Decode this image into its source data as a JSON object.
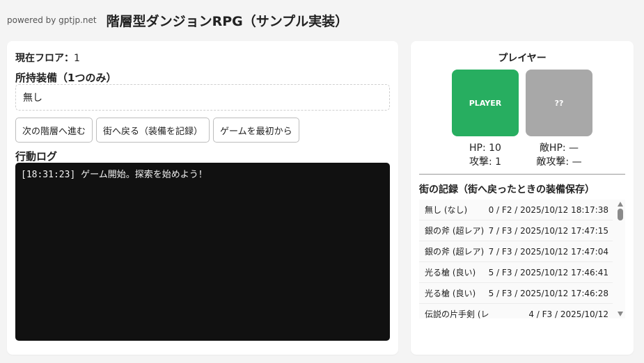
{
  "header": {
    "powered_by": "powered by gptjp.net",
    "title": "階層型ダンジョンRPG（サンプル実装）"
  },
  "left": {
    "floor_label": "現在フロア：",
    "floor_value": "1",
    "equip_label": "所持装備（1つのみ）",
    "equip_value": "無し",
    "buttons": {
      "next": "次の階層へ進む",
      "town": "街へ戻る（装備を記録）",
      "restart": "ゲームを最初から"
    },
    "log_label": "行動ログ",
    "log_lines": [
      "[18:31:23] ゲーム開始。探索を始めよう！"
    ]
  },
  "right": {
    "title": "プレイヤー",
    "player_card": "PLAYER",
    "enemy_card": "??",
    "player_hp": "HP: 10",
    "player_atk": "攻撃: 1",
    "enemy_hp": "敵HP: —",
    "enemy_atk": "敵攻撃: —",
    "records_title": "街の記録（街へ戻ったときの装備保存）",
    "records": [
      {
        "item": "無し (なし)",
        "info": "0 / F2 / 2025/10/12 18:17:38"
      },
      {
        "item": "銀の斧 (超レア)",
        "info": "7 / F3 / 2025/10/12 17:47:15"
      },
      {
        "item": "銀の斧 (超レア)",
        "info": "7 / F3 / 2025/10/12 17:47:04"
      },
      {
        "item": "光る槍 (良い)",
        "info": "5 / F3 / 2025/10/12 17:46:41"
      },
      {
        "item": "光る槍 (良い)",
        "info": "5 / F3 / 2025/10/12 17:46:28"
      },
      {
        "item": "伝説の片手剣 (レ",
        "info": "4 / F3 / 2025/10/12"
      }
    ]
  },
  "colors": {
    "player": "#27ae60",
    "enemy": "#a8a8a8",
    "log_bg": "#111111"
  }
}
